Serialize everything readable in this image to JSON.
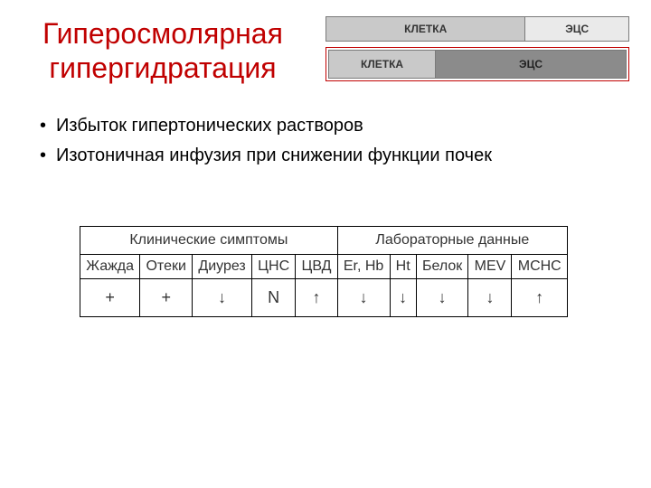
{
  "title_line1": "Гиперосмолярная",
  "title_line2": "гипергидратация",
  "diagram": {
    "row1": {
      "left": "КЛЕТКА",
      "right": "ЭЦС"
    },
    "row2": {
      "left": "КЛЕТКА",
      "right": "ЭЦС"
    }
  },
  "bullets": [
    "Избыток гипертонических растворов",
    "Изотоничная инфузия при снижении функции почек"
  ],
  "table": {
    "group_headers": [
      "Клинические симптомы",
      "Лабораторные данные"
    ],
    "columns_group1": [
      "Жажда",
      "Отеки",
      "Диурез",
      "ЦНС",
      "ЦВД"
    ],
    "columns_group2": [
      "Er, Hb",
      "Ht",
      "Белок",
      "MEV",
      "MCHC"
    ],
    "values_group1": [
      "+",
      "+",
      "↓",
      "N",
      "↑"
    ],
    "values_group2": [
      "↓",
      "↓",
      "↓",
      "↓",
      "↑"
    ]
  },
  "chart_data": {
    "type": "table",
    "title": "Гиперосмолярная гипергидратация — клинические и лабораторные показатели",
    "columns": [
      "Жажда",
      "Отеки",
      "Диурез",
      "ЦНС",
      "ЦВД",
      "Er, Hb",
      "Ht",
      "Белок",
      "MEV",
      "MCHC"
    ],
    "rows": [
      {
        "group": "Клинические симптомы",
        "Жажда": "+",
        "Отеки": "+",
        "Диурез": "↓",
        "ЦНС": "N",
        "ЦВД": "↑"
      },
      {
        "group": "Лабораторные данные",
        "Er, Hb": "↓",
        "Ht": "↓",
        "Белок": "↓",
        "MEV": "↓",
        "MCHC": "↑"
      }
    ]
  }
}
